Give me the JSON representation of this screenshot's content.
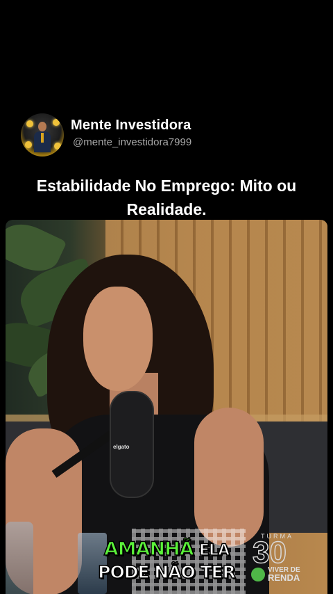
{
  "channel": {
    "name": "Mente Investidora",
    "handle": "@mente_investidora7999"
  },
  "post": {
    "title": "Estabilidade No Emprego: Mito ou Realidade."
  },
  "video": {
    "caption_line1_highlight": "AMANHÃ",
    "caption_line1_rest": "ELA",
    "caption_line2": "PODE NÃO TER",
    "mic_brand": "elgato",
    "logo": {
      "turma": "TURMA",
      "number": "30",
      "brand_line1": "VIVER DE",
      "brand_line2": "RENDA"
    }
  },
  "colors": {
    "background": "#000000",
    "caption_highlight": "#5bf23a",
    "brand_green": "#4fb848"
  }
}
